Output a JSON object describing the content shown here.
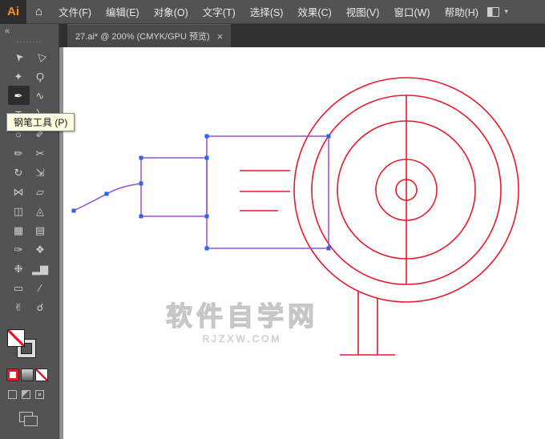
{
  "app": {
    "logo": "Ai",
    "home_icon": "⌂",
    "workspace_caret": "▾"
  },
  "menu": {
    "items": [
      "文件(F)",
      "编辑(E)",
      "对象(O)",
      "文字(T)",
      "选择(S)",
      "效果(C)",
      "视图(V)",
      "窗口(W)",
      "帮助(H)"
    ]
  },
  "tab": {
    "title": "27.ai* @ 200% (CMYK/GPU 预览)",
    "close": "×"
  },
  "tooltip": {
    "text": "钢笔工具 (P)"
  },
  "toolbar": {
    "collapse": "«",
    "grip": "········",
    "tools": [
      {
        "name": "selection",
        "glyph": "➤"
      },
      {
        "name": "direct-selection",
        "glyph": "▷"
      },
      {
        "name": "magic-wand",
        "glyph": "✦"
      },
      {
        "name": "lasso",
        "glyph": "Ϙ"
      },
      {
        "name": "pen",
        "glyph": "✒",
        "active": true
      },
      {
        "name": "curvature",
        "glyph": "∿"
      },
      {
        "name": "type",
        "glyph": "T"
      },
      {
        "name": "line-segment",
        "glyph": "╲"
      },
      {
        "name": "ellipse",
        "glyph": "○"
      },
      {
        "name": "paintbrush",
        "glyph": "✐"
      },
      {
        "name": "pencil",
        "glyph": "✏"
      },
      {
        "name": "scissors",
        "glyph": "✂"
      },
      {
        "name": "rotate",
        "glyph": "↻"
      },
      {
        "name": "scale",
        "glyph": "⇲"
      },
      {
        "name": "width",
        "glyph": "⋈"
      },
      {
        "name": "free-transform",
        "glyph": "▱"
      },
      {
        "name": "shape-builder",
        "glyph": "◫"
      },
      {
        "name": "perspective-grid",
        "glyph": "◬"
      },
      {
        "name": "mesh",
        "glyph": "▦"
      },
      {
        "name": "gradient",
        "glyph": "▤"
      },
      {
        "name": "eyedropper",
        "glyph": "✑"
      },
      {
        "name": "blend",
        "glyph": "❖"
      },
      {
        "name": "symbol-sprayer",
        "glyph": "❉"
      },
      {
        "name": "column-graph",
        "glyph": "▂▆"
      },
      {
        "name": "artboard",
        "glyph": "▭"
      },
      {
        "name": "slice",
        "glyph": "∕"
      },
      {
        "name": "hand",
        "glyph": "✌"
      },
      {
        "name": "zoom",
        "glyph": "☌"
      }
    ]
  },
  "watermark": {
    "line1": "软件自学网",
    "line2": "RJZXW.COM"
  },
  "colors": {
    "artwork_stroke_red": "#e8192c",
    "selected_path_purple": "#9b4fd0",
    "anchor_blue": "#2e62e8",
    "tooltip_bg": "#ffffe1",
    "accent_orange": "#ff8d1e",
    "ui_gray": "#535353"
  }
}
